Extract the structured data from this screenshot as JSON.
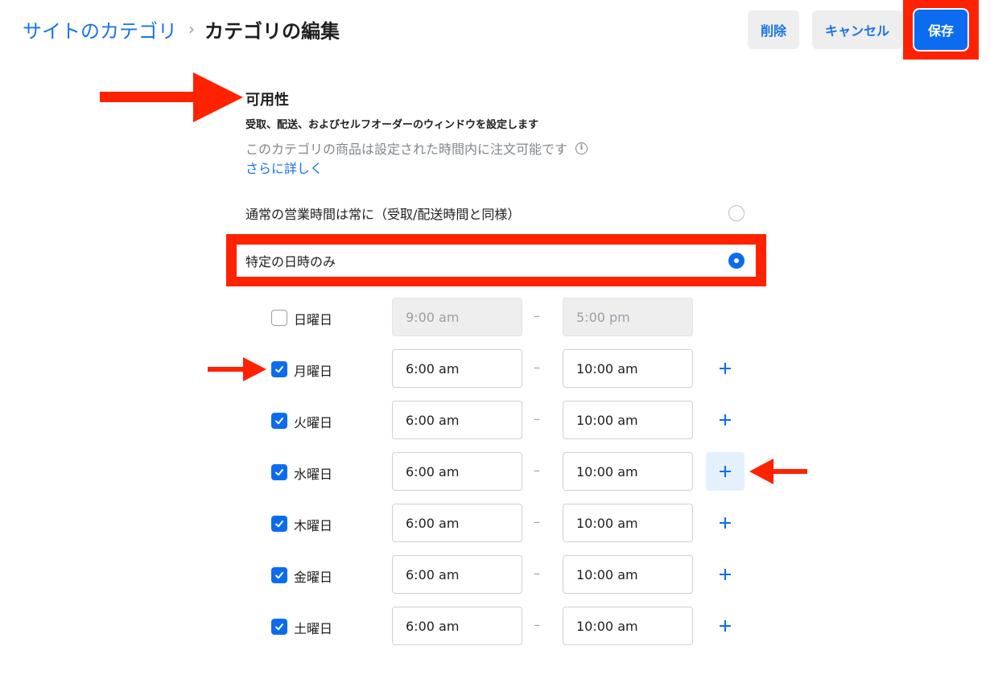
{
  "header": {
    "breadcrumb_parent": "サイトのカテゴリ",
    "breadcrumb_separator": "›",
    "breadcrumb_current": "カテゴリの編集",
    "delete_label": "削除",
    "cancel_label": "キャンセル",
    "save_label": "保存"
  },
  "availability": {
    "title": "可用性",
    "subtitle": "受取、配送、およびセルフオーダーのウィンドウを設定します",
    "description": "このカテゴリの商品は設定された時間内に注文可能です",
    "info_icon_glyph": "i",
    "learn_more": "さらに詳しく",
    "options": [
      {
        "label": "通常の営業時間は常に（受取/配送時間と同様）",
        "selected": false
      },
      {
        "label": "特定の日時のみ",
        "selected": true
      }
    ]
  },
  "schedule": {
    "separator": "–",
    "days": [
      {
        "label": "日曜日",
        "checked": false,
        "start": "9:00 am",
        "end": "5:00 pm"
      },
      {
        "label": "月曜日",
        "checked": true,
        "start": "6:00 am",
        "end": "10:00 am"
      },
      {
        "label": "火曜日",
        "checked": true,
        "start": "6:00 am",
        "end": "10:00 am"
      },
      {
        "label": "水曜日",
        "checked": true,
        "start": "6:00 am",
        "end": "10:00 am"
      },
      {
        "label": "木曜日",
        "checked": true,
        "start": "6:00 am",
        "end": "10:00 am"
      },
      {
        "label": "金曜日",
        "checked": true,
        "start": "6:00 am",
        "end": "10:00 am"
      },
      {
        "label": "土曜日",
        "checked": true,
        "start": "6:00 am",
        "end": "10:00 am"
      }
    ]
  },
  "colors": {
    "accent": "#0b6cf0",
    "link": "#1a73e8",
    "annotation": "#ff2200",
    "disabled_field": "#eeeeee"
  }
}
